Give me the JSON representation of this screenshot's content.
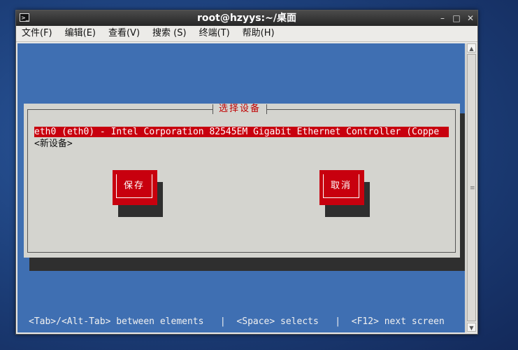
{
  "window": {
    "title": "root@hzyys:~/桌面",
    "controls": {
      "minimize": "–",
      "maximize": "□",
      "close": "✕"
    }
  },
  "menubar": {
    "items": [
      {
        "label": "文件(F)"
      },
      {
        "label": "编辑(E)"
      },
      {
        "label": "查看(V)"
      },
      {
        "label": "搜索 (S)"
      },
      {
        "label": "终端(T)"
      },
      {
        "label": "帮助(H)"
      }
    ]
  },
  "dialog": {
    "title": "选择设备",
    "devices": [
      {
        "label": "eth0 (eth0) - Intel Corporation 82545EM Gigabit Ethernet Controller (Coppe",
        "selected": true
      },
      {
        "label": "<新设备>",
        "selected": false
      }
    ],
    "save_label": "保存",
    "cancel_label": "取消"
  },
  "hint_bar": {
    "text": "<Tab>/<Alt-Tab> between elements   |  <Space> selects   |  <F12> next screen"
  },
  "colors": {
    "terminal_bg": "#3f6fb2",
    "dialog_bg": "#d4d4cf",
    "accent_red": "#c8000e"
  }
}
